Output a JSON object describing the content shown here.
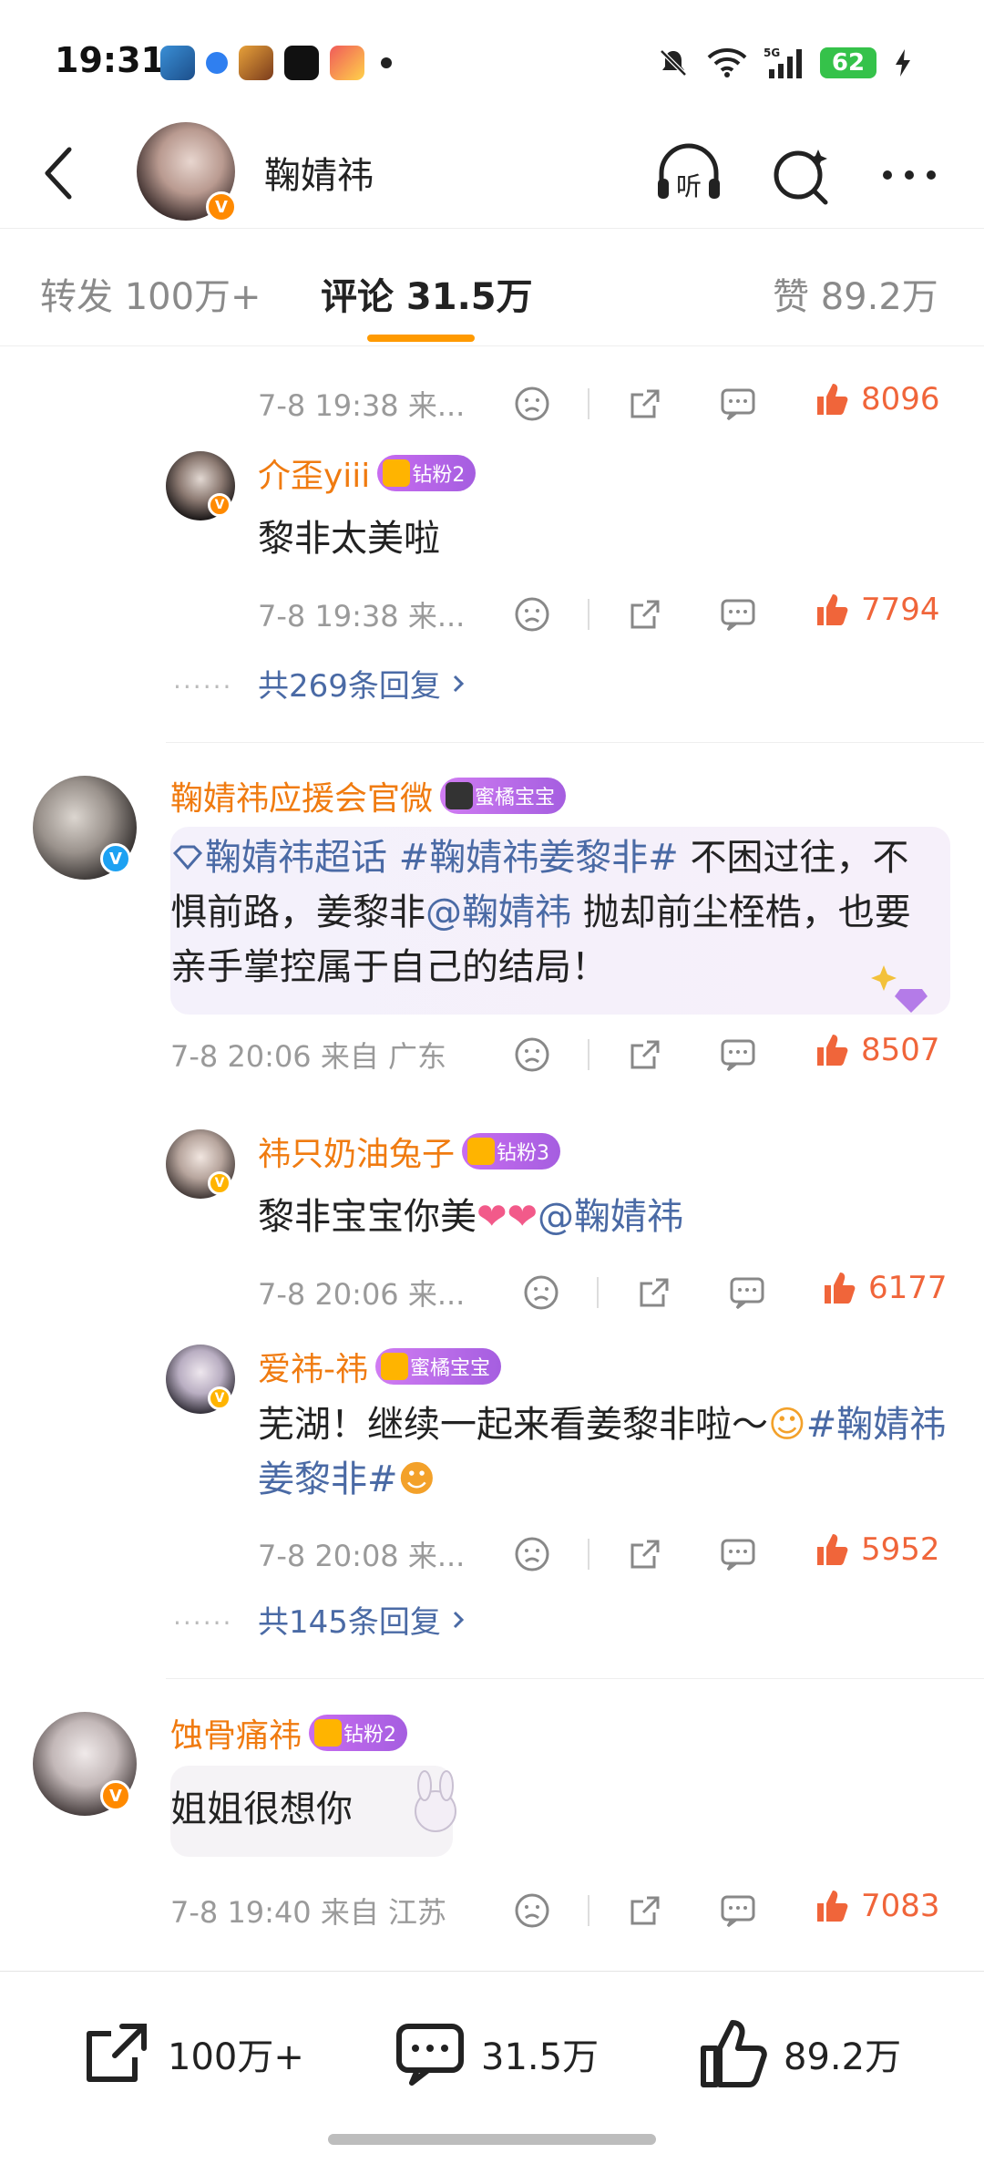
{
  "status_bar": {
    "time": "19:31",
    "battery": "62",
    "network": "5G"
  },
  "header": {
    "title": "鞠婧祎",
    "listen_label": "听"
  },
  "tabs": [
    {
      "label": "转发 100万+"
    },
    {
      "label": "评论 31.5万"
    },
    {
      "label": "赞 89.2万"
    }
  ],
  "comments": {
    "top_meta": {
      "time": "7-8 19:38 来...",
      "likes": "8096"
    },
    "reply1": {
      "name": "介歪yiii",
      "badge": "钻粉2",
      "text": "黎非太美啦",
      "time": "7-8 19:38 来...",
      "likes": "7794"
    },
    "more1": "共269条回复",
    "c2": {
      "name": "鞠婧祎应援会官微",
      "badge": "蜜橘宝宝",
      "text_topic1": "鞠婧祎超话",
      "text_topic2": "#鞠婧祎姜黎非#",
      "text_a": " 不困过往，不惧前路，姜黎非",
      "text_mention": "@鞠婧祎",
      "text_b": " 抛却前尘桎梏，也要亲手掌控属于自己的结局！",
      "time": "7-8 20:06 来自 广东",
      "likes": "8507"
    },
    "reply2": {
      "name": "祎只奶油兔子",
      "badge": "钻粉3",
      "text": "黎非宝宝你美",
      "mention": "@鞠婧祎",
      "time": "7-8 20:06 来...",
      "likes": "6177"
    },
    "reply3": {
      "name": "爱祎-祎",
      "badge": "蜜橘宝宝",
      "text": "芜湖！继续一起来看姜黎非啦～",
      "topic": "#鞠婧祎姜黎非#",
      "time": "7-8 20:08 来...",
      "likes": "5952"
    },
    "more2": "共145条回复",
    "c3": {
      "name": "蚀骨痛祎",
      "badge": "钻粉2",
      "text": "姐姐很想你",
      "time": "7-8 19:40 来自 江苏",
      "likes": "7083"
    }
  },
  "bottom_bar": {
    "repost": "100万+",
    "comment": "31.5万",
    "like": "89.2万"
  },
  "colors": {
    "accent": "#ff9a00",
    "name": "#f07b10",
    "link": "#4a6aa5",
    "like": "#f0653a"
  }
}
